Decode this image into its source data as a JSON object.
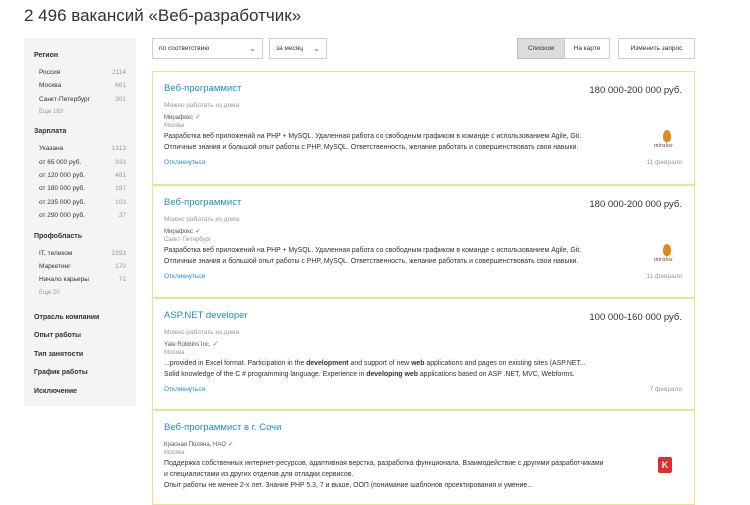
{
  "page": {
    "title": "2 496 вакансий «Веб-разработчик»"
  },
  "sidebar": {
    "region": {
      "heading": "Регион",
      "items": [
        {
          "label": "Россия",
          "count": "2114"
        },
        {
          "label": "Москва",
          "count": "661"
        },
        {
          "label": "Санкт-Петербург",
          "count": "301"
        }
      ],
      "more": "Еще 183"
    },
    "salary": {
      "heading": "Зарплата",
      "items": [
        {
          "label": "Указана",
          "count": "1313"
        },
        {
          "label": "от 65 000 руб.",
          "count": "933"
        },
        {
          "label": "от 120 000 руб.",
          "count": "481"
        },
        {
          "label": "от 180 000 руб.",
          "count": "197"
        },
        {
          "label": "от 235 000 руб.",
          "count": "103"
        },
        {
          "label": "от 290 000 руб.",
          "count": "37"
        }
      ]
    },
    "area": {
      "heading": "Профобласть",
      "items": [
        {
          "label": "IT, телеком",
          "count": "2393"
        },
        {
          "label": "Маркетинг",
          "count": "170"
        },
        {
          "label": "Начало карьеры",
          "count": "71"
        }
      ],
      "more": "Еще 20"
    },
    "sections": [
      "Отрасль компании",
      "Опыт работы",
      "Тип занятости",
      "График работы",
      "Исключение"
    ]
  },
  "controls": {
    "sort": "по соответствию",
    "period": "за месяц",
    "view_list": "Списком",
    "view_map": "На карте",
    "change_query": "Изменить запрос"
  },
  "vacancies": [
    {
      "title": "Веб-программист",
      "salary": "180 000-200 000 руб.",
      "remote": "Можно работать из дома",
      "company": "Мирафокс",
      "city": "Москва",
      "desc1": "Разработка веб приложений на PHP + MySQL. Удаленная работа со свободным графиком в команде с использованием Agile, Git.",
      "desc2": "Отличные знания и большой опыт работы с PHP, MySQL. Ответственность, желание работать и совершенствовать свои навыки.",
      "respond": "Откликнуться",
      "date": "11 февраля",
      "logo": "miralox"
    },
    {
      "title": "Веб-программист",
      "salary": "180 000-200 000 руб.",
      "remote": "Можно работать из дома",
      "company": "Мирафокс",
      "city": "Санкт-Петербург",
      "desc1": "Разработка веб приложений на PHP + MySQL. Удаленная работа со свободным графиком в команде с использованием Agile, Git.",
      "desc2": "Отличные знания и большой опыт работы с PHP, MySQL. Ответственность, желание работать и совершенствовать свои навыки.",
      "respond": "Откликнуться",
      "date": "11 февраля",
      "logo": "miralox"
    },
    {
      "title": "ASP.NET developer",
      "salary": "100 000-160 000 руб.",
      "remote": "Можно работать из дома",
      "company": "Yale Robbins Inc.",
      "city": "Москва",
      "desc1_parts": [
        "...provided in Excel format. Participation in the ",
        "development",
        " and support of new ",
        "web",
        " applications and pages on existing sites (ASP.NET..."
      ],
      "desc2_parts": [
        "Solid knowledge of the C # programming language. Experience in ",
        "developing web",
        " applications based on ASP .NET, MVC, Webforms."
      ],
      "respond": "Откликнуться",
      "date": "7 февраля"
    },
    {
      "title": "Веб-программист в г. Сочи",
      "company": "Красная Поляна, НАО",
      "city": "Москва",
      "desc1": "Поддержка собственных интернет-ресурсов, адаптивная верстка, разработка функционала. Взаимодействие с другими разработчиками",
      "desc1b": "и специалистами из других отделов для отладки сервисов.",
      "desc2": "Опыт работы не менее 2-х лет. Знание PHP 5.3, 7 и выше, ООП (понимание шаблонов проектирования и умение...",
      "logo": "K"
    }
  ],
  "logo_text": "miralox",
  "colors": {
    "link": "#1a8fcc",
    "card_border": "#f0e18a",
    "sidebar_bg": "#f4f4f4",
    "check": "#3d9a52"
  }
}
